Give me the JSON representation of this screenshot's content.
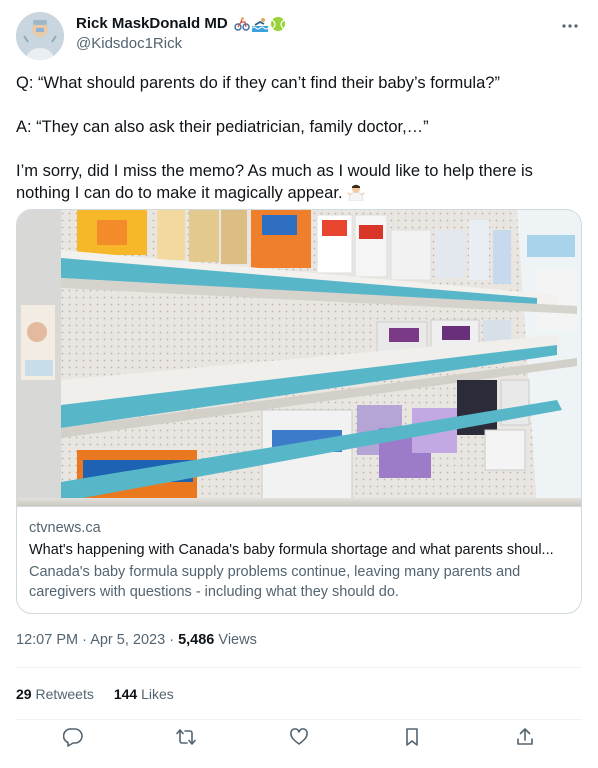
{
  "author": {
    "display_name": "Rick MaskDonald MD",
    "handle": "@Kidsdoc1Rick",
    "badges": [
      "bicycle-emoji",
      "swimmer-emoji",
      "tennis-ball-emoji"
    ]
  },
  "tweet": {
    "paragraph1": "Q: “What should parents do if they can’t find their baby’s formula?”",
    "paragraph2": "A: “They can also ask their pediatrician, family doctor,…”",
    "paragraph3": "I’m sorry, did I miss the memo? As much as I would like to help there is nothing I can do to make it magically appear.",
    "trailing_emoji": "person-shrugging-emoji"
  },
  "card": {
    "domain": "ctvnews.ca",
    "title": "What's happening with Canada's baby formula shortage and what parents shoul...",
    "description": "Canada's baby formula supply problems continue, leaving many parents and caregivers with questions - including what they should do."
  },
  "meta": {
    "time": "12:07 PM",
    "date": "Apr 5, 2023",
    "separator": "·",
    "views_count": "5,486",
    "views_label": "Views"
  },
  "stats": {
    "retweets_count": "29",
    "retweets_label": "Retweets",
    "likes_count": "144",
    "likes_label": "Likes"
  },
  "colors": {
    "text": "#0f1419",
    "muted": "#536471",
    "border": "#cfd9de"
  }
}
